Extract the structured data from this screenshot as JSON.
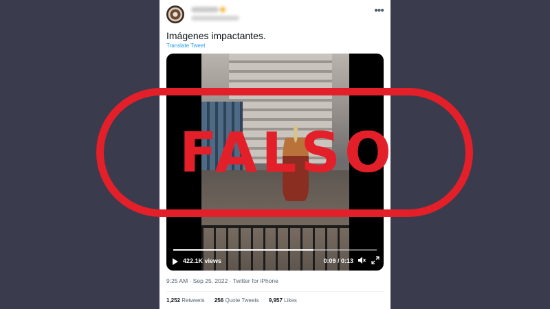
{
  "tweet": {
    "text": "Imágenes impactantes.",
    "translate_label": "Translate Tweet",
    "more_glyph": "•••",
    "meta": "9:25 AM · Sep 25, 2022 · Twitter for iPhone"
  },
  "video": {
    "views": "422.1K views",
    "time": "0:09 / 0:13",
    "progress": 0.69
  },
  "stats": {
    "retweets_count": "1,252",
    "retweets_label": "Retweets",
    "quotes_count": "256",
    "quotes_label": "Quote Tweets",
    "likes_count": "9,957",
    "likes_label": "Likes"
  },
  "stamp": {
    "text": "FALSO",
    "color": "#e3202a"
  },
  "colors": {
    "background": "#3a3b4c",
    "link": "#1d9bf0",
    "text_secondary": "#536471"
  },
  "icons": [
    "more-icon",
    "play-icon",
    "volume-icon",
    "fullscreen-icon"
  ]
}
